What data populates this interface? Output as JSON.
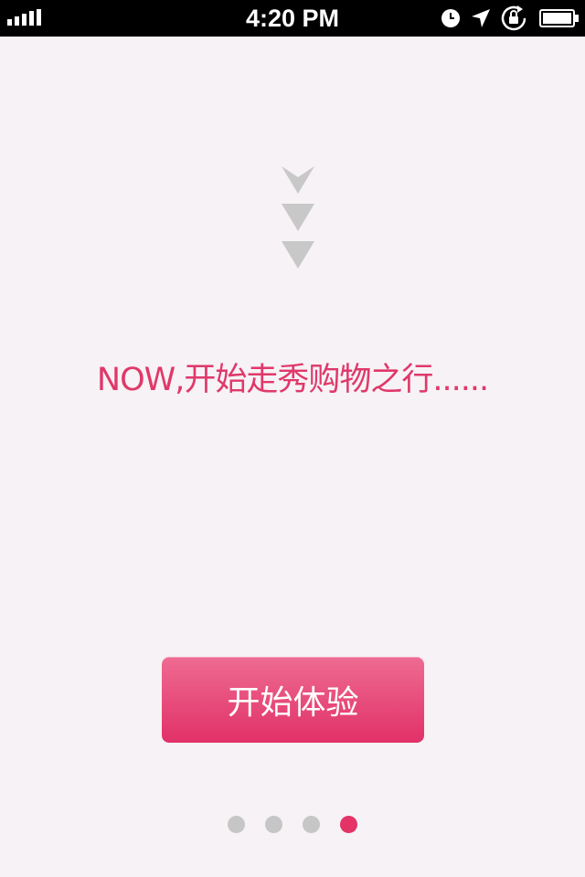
{
  "status_bar": {
    "time": "4:20 PM",
    "icons": [
      "signal-bars-icon",
      "clock-icon",
      "location-arrow-icon",
      "rotation-lock-icon",
      "battery-icon"
    ]
  },
  "intro": {
    "decoration": "down-chevrons-icon",
    "tagline": "NOW,开始走秀购物之行......",
    "start_button_label": "开始体验"
  },
  "pager": {
    "total": 4,
    "current": 4
  },
  "colors": {
    "accent": "#e33367",
    "background": "#f6f2f5",
    "inactive_dot": "#c6c6c6",
    "arrow": "#c8c8c8"
  }
}
